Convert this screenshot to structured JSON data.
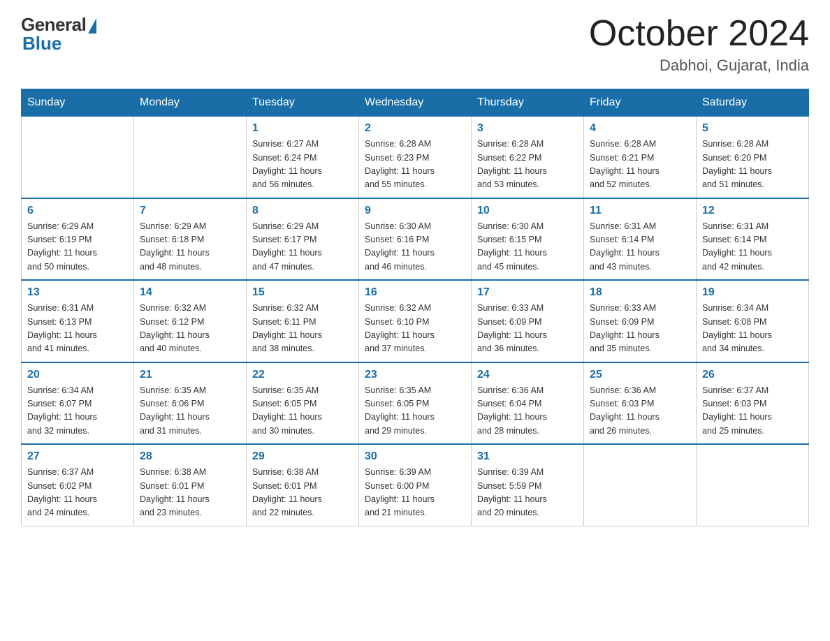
{
  "logo": {
    "general": "General",
    "blue": "Blue"
  },
  "title": "October 2024",
  "location": "Dabhoi, Gujarat, India",
  "days_of_week": [
    "Sunday",
    "Monday",
    "Tuesday",
    "Wednesday",
    "Thursday",
    "Friday",
    "Saturday"
  ],
  "weeks": [
    [
      {
        "day": "",
        "info": ""
      },
      {
        "day": "",
        "info": ""
      },
      {
        "day": "1",
        "info": "Sunrise: 6:27 AM\nSunset: 6:24 PM\nDaylight: 11 hours\nand 56 minutes."
      },
      {
        "day": "2",
        "info": "Sunrise: 6:28 AM\nSunset: 6:23 PM\nDaylight: 11 hours\nand 55 minutes."
      },
      {
        "day": "3",
        "info": "Sunrise: 6:28 AM\nSunset: 6:22 PM\nDaylight: 11 hours\nand 53 minutes."
      },
      {
        "day": "4",
        "info": "Sunrise: 6:28 AM\nSunset: 6:21 PM\nDaylight: 11 hours\nand 52 minutes."
      },
      {
        "day": "5",
        "info": "Sunrise: 6:28 AM\nSunset: 6:20 PM\nDaylight: 11 hours\nand 51 minutes."
      }
    ],
    [
      {
        "day": "6",
        "info": "Sunrise: 6:29 AM\nSunset: 6:19 PM\nDaylight: 11 hours\nand 50 minutes."
      },
      {
        "day": "7",
        "info": "Sunrise: 6:29 AM\nSunset: 6:18 PM\nDaylight: 11 hours\nand 48 minutes."
      },
      {
        "day": "8",
        "info": "Sunrise: 6:29 AM\nSunset: 6:17 PM\nDaylight: 11 hours\nand 47 minutes."
      },
      {
        "day": "9",
        "info": "Sunrise: 6:30 AM\nSunset: 6:16 PM\nDaylight: 11 hours\nand 46 minutes."
      },
      {
        "day": "10",
        "info": "Sunrise: 6:30 AM\nSunset: 6:15 PM\nDaylight: 11 hours\nand 45 minutes."
      },
      {
        "day": "11",
        "info": "Sunrise: 6:31 AM\nSunset: 6:14 PM\nDaylight: 11 hours\nand 43 minutes."
      },
      {
        "day": "12",
        "info": "Sunrise: 6:31 AM\nSunset: 6:14 PM\nDaylight: 11 hours\nand 42 minutes."
      }
    ],
    [
      {
        "day": "13",
        "info": "Sunrise: 6:31 AM\nSunset: 6:13 PM\nDaylight: 11 hours\nand 41 minutes."
      },
      {
        "day": "14",
        "info": "Sunrise: 6:32 AM\nSunset: 6:12 PM\nDaylight: 11 hours\nand 40 minutes."
      },
      {
        "day": "15",
        "info": "Sunrise: 6:32 AM\nSunset: 6:11 PM\nDaylight: 11 hours\nand 38 minutes."
      },
      {
        "day": "16",
        "info": "Sunrise: 6:32 AM\nSunset: 6:10 PM\nDaylight: 11 hours\nand 37 minutes."
      },
      {
        "day": "17",
        "info": "Sunrise: 6:33 AM\nSunset: 6:09 PM\nDaylight: 11 hours\nand 36 minutes."
      },
      {
        "day": "18",
        "info": "Sunrise: 6:33 AM\nSunset: 6:09 PM\nDaylight: 11 hours\nand 35 minutes."
      },
      {
        "day": "19",
        "info": "Sunrise: 6:34 AM\nSunset: 6:08 PM\nDaylight: 11 hours\nand 34 minutes."
      }
    ],
    [
      {
        "day": "20",
        "info": "Sunrise: 6:34 AM\nSunset: 6:07 PM\nDaylight: 11 hours\nand 32 minutes."
      },
      {
        "day": "21",
        "info": "Sunrise: 6:35 AM\nSunset: 6:06 PM\nDaylight: 11 hours\nand 31 minutes."
      },
      {
        "day": "22",
        "info": "Sunrise: 6:35 AM\nSunset: 6:05 PM\nDaylight: 11 hours\nand 30 minutes."
      },
      {
        "day": "23",
        "info": "Sunrise: 6:35 AM\nSunset: 6:05 PM\nDaylight: 11 hours\nand 29 minutes."
      },
      {
        "day": "24",
        "info": "Sunrise: 6:36 AM\nSunset: 6:04 PM\nDaylight: 11 hours\nand 28 minutes."
      },
      {
        "day": "25",
        "info": "Sunrise: 6:36 AM\nSunset: 6:03 PM\nDaylight: 11 hours\nand 26 minutes."
      },
      {
        "day": "26",
        "info": "Sunrise: 6:37 AM\nSunset: 6:03 PM\nDaylight: 11 hours\nand 25 minutes."
      }
    ],
    [
      {
        "day": "27",
        "info": "Sunrise: 6:37 AM\nSunset: 6:02 PM\nDaylight: 11 hours\nand 24 minutes."
      },
      {
        "day": "28",
        "info": "Sunrise: 6:38 AM\nSunset: 6:01 PM\nDaylight: 11 hours\nand 23 minutes."
      },
      {
        "day": "29",
        "info": "Sunrise: 6:38 AM\nSunset: 6:01 PM\nDaylight: 11 hours\nand 22 minutes."
      },
      {
        "day": "30",
        "info": "Sunrise: 6:39 AM\nSunset: 6:00 PM\nDaylight: 11 hours\nand 21 minutes."
      },
      {
        "day": "31",
        "info": "Sunrise: 6:39 AM\nSunset: 5:59 PM\nDaylight: 11 hours\nand 20 minutes."
      },
      {
        "day": "",
        "info": ""
      },
      {
        "day": "",
        "info": ""
      }
    ]
  ]
}
